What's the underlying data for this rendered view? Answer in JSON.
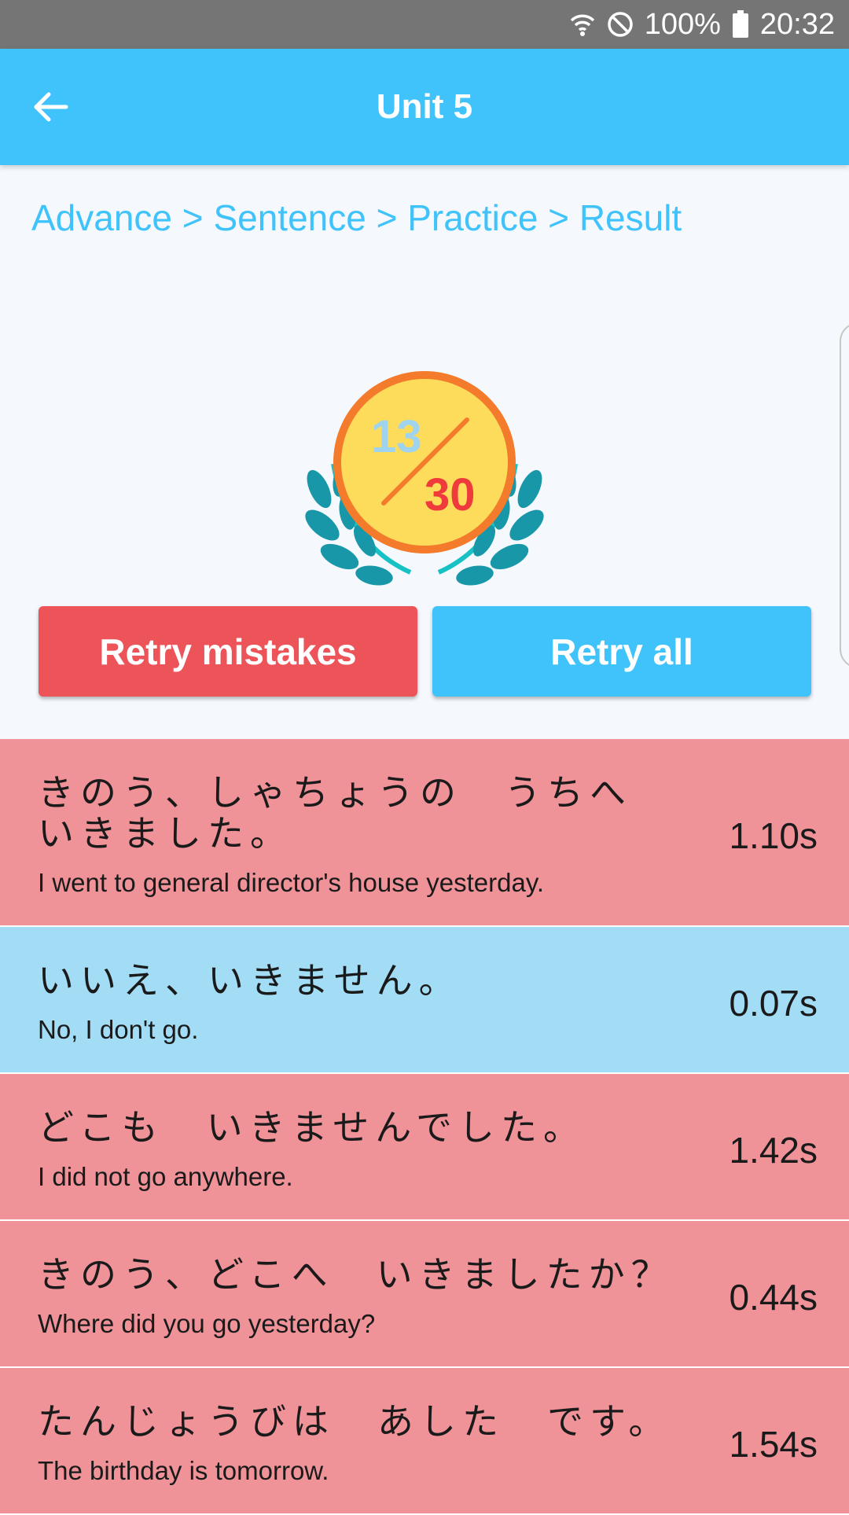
{
  "status_bar": {
    "icons": [
      "wifi-icon",
      "do-not-disturb-icon",
      "battery-icon"
    ],
    "battery": "100%",
    "time": "20:32"
  },
  "app_bar": {
    "title": "Unit 5",
    "back_icon": "arrow-left-icon"
  },
  "breadcrumb": "Advance > Sentence > Practice > Result",
  "score": {
    "correct": "13",
    "total": "30"
  },
  "buttons": {
    "retry_mistakes": "Retry mistakes",
    "retry_all": "Retry all"
  },
  "colors": {
    "accent": "#40c3fb",
    "mistake": "#ec5459",
    "wrong_row": "#ef9399",
    "right_row": "#a3dcf5",
    "medal_ring": "#f47b2b",
    "medal_fill": "#fddc5c",
    "laurel": "#1797a8"
  },
  "results": [
    {
      "status": "wrong",
      "japanese": "きのう、しゃちょうの　うちへ　いきました。",
      "english": "I went to general director's house yesterday.",
      "time": "1.10s"
    },
    {
      "status": "right",
      "japanese": "いいえ、いきません。",
      "english": "No, I don't go.",
      "time": "0.07s"
    },
    {
      "status": "wrong",
      "japanese": "どこも　いきませんでした。",
      "english": "I did not go anywhere.",
      "time": "1.42s"
    },
    {
      "status": "wrong",
      "japanese": "きのう、どこへ　いきましたか？",
      "english": "Where did you go yesterday?",
      "time": "0.44s"
    },
    {
      "status": "wrong",
      "japanese": "たんじょうびは　あした　です。",
      "english": "The birthday is tomorrow.",
      "time": "1.54s"
    }
  ]
}
